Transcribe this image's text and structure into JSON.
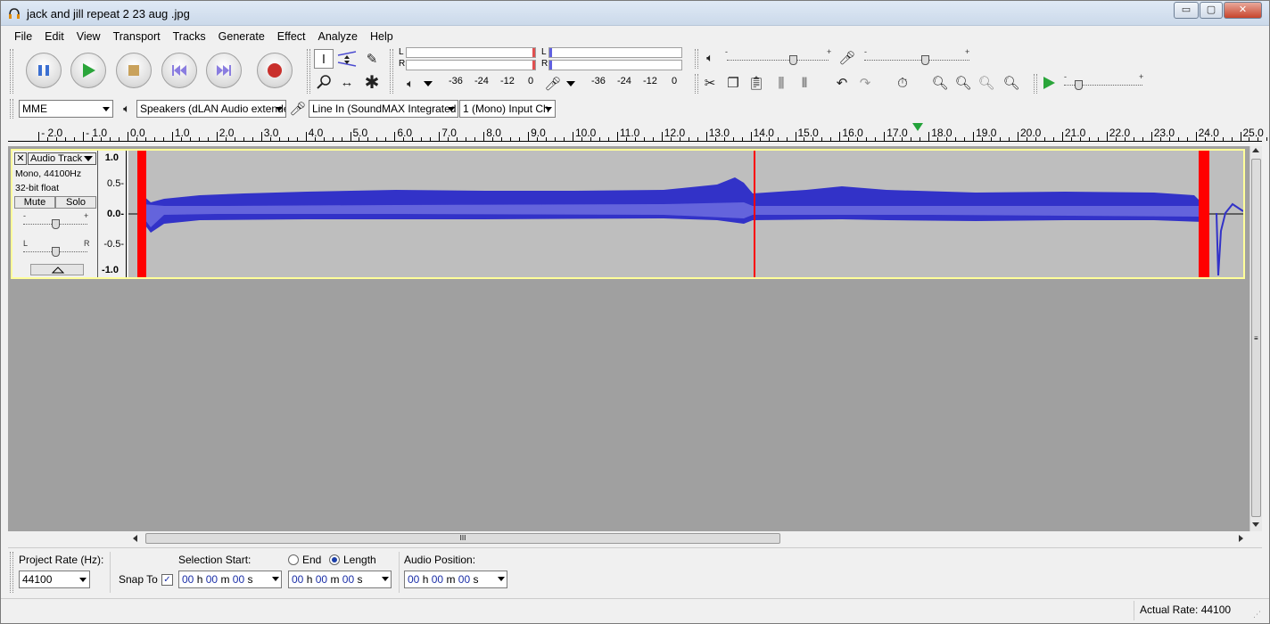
{
  "window": {
    "title": "jack and jill repeat 2 23 aug .jpg",
    "min": "▭",
    "max": "▢",
    "close": "✕"
  },
  "menu": [
    "File",
    "Edit",
    "View",
    "Transport",
    "Tracks",
    "Generate",
    "Effect",
    "Analyze",
    "Help"
  ],
  "transport": {
    "pause_icon": "pause-icon",
    "play_icon": "play-icon",
    "stop_icon": "stop-icon",
    "skip_start_icon": "skip-start-icon",
    "skip_end_icon": "skip-end-icon",
    "record_icon": "record-icon"
  },
  "meters": {
    "L": "L",
    "R": "R",
    "play_scale": [
      "-36",
      "-24",
      "-12",
      "0"
    ],
    "rec_scale": [
      "-36",
      "-24",
      "-12",
      "0"
    ]
  },
  "mixer": {
    "minus": "-",
    "plus": "+"
  },
  "device": {
    "host": "MME",
    "output": "Speakers (dLAN Audio extende",
    "input": "Line In (SoundMAX Integrated",
    "channels": "1 (Mono) Input Ch"
  },
  "ruler": [
    "- 2.0",
    "- 1.0",
    "0.0",
    "1.0",
    "2.0",
    "3.0",
    "4.0",
    "5.0",
    "6.0",
    "7.0",
    "8.0",
    "9.0",
    "10.0",
    "11.0",
    "12.0",
    "13.0",
    "14.0",
    "15.0",
    "16.0",
    "17.0",
    "18.0",
    "19.0",
    "20.0",
    "21.0",
    "22.0",
    "23.0",
    "24.0",
    "25.0"
  ],
  "track": {
    "name": "Audio Track",
    "format": "Mono, 44100Hz",
    "bits": "32-bit float",
    "mute": "Mute",
    "solo": "Solo",
    "gain_minus": "-",
    "gain_plus": "+",
    "pan_l": "L",
    "pan_r": "R",
    "close": "✕"
  },
  "vruler": [
    "1.0",
    "0.5-",
    "0.0-",
    "-0.5-",
    "-1.0"
  ],
  "hscroll_grip": "III",
  "selection": {
    "rate_label": "Project Rate (Hz):",
    "rate": "44100",
    "snap_label": "Snap To",
    "start_label": "Selection Start:",
    "end_label": "End",
    "length_label": "Length",
    "position_label": "Audio Position:",
    "start": {
      "h": "00",
      "m": "00",
      "s": "00"
    },
    "end": {
      "h": "00",
      "m": "00",
      "s": "00"
    },
    "pos": {
      "h": "00",
      "m": "00",
      "s": "00"
    },
    "h": "h",
    "m": "m",
    "s": "s"
  },
  "status": {
    "rate": "Actual Rate: 44100"
  }
}
